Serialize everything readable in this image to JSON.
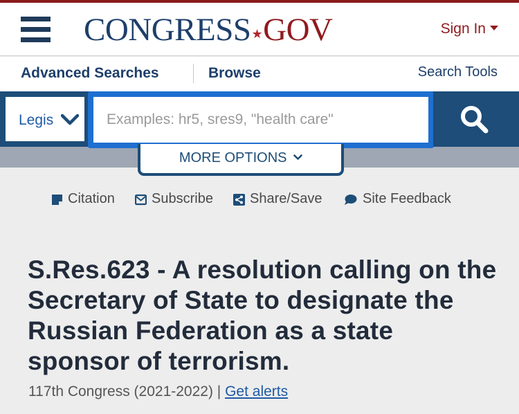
{
  "header": {
    "logo_part1": "CONGRESS",
    "logo_star": "★",
    "logo_part2": "GOV",
    "sign_in": "Sign In",
    "menu_icon": "hamburger-icon"
  },
  "subnav": {
    "advanced_searches": "Advanced Searches",
    "browse": "Browse",
    "search_tools": "Search Tools"
  },
  "search": {
    "collection_selected": "Legislation",
    "placeholder": "Examples: hr5, sres9, \"health care\"",
    "more_options": "MORE OPTIONS",
    "search_icon": "magnifier-icon"
  },
  "actions": [
    {
      "label": "Citation",
      "icon": "bookmark-icon"
    },
    {
      "label": "Subscribe",
      "icon": "envelope-icon"
    },
    {
      "label": "Share/Save",
      "icon": "share-icon"
    },
    {
      "label": "Site Feedback",
      "icon": "speech-bubble-icon"
    }
  ],
  "bill": {
    "title": "S.Res.623 - A resolution calling on the Secretary of State to designate the Russian Federation as a state sponsor of terrorism.",
    "congress": "117th Congress (2021-2022) | ",
    "alerts_link": "Get alerts"
  },
  "colors": {
    "brand_navy": "#1d3f6b",
    "brand_red": "#8f1b1f",
    "search_bar": "#1d4d78",
    "focus_blue": "#1f6fd1",
    "link_blue": "#1f5aa6",
    "page_bg": "#ededed"
  }
}
